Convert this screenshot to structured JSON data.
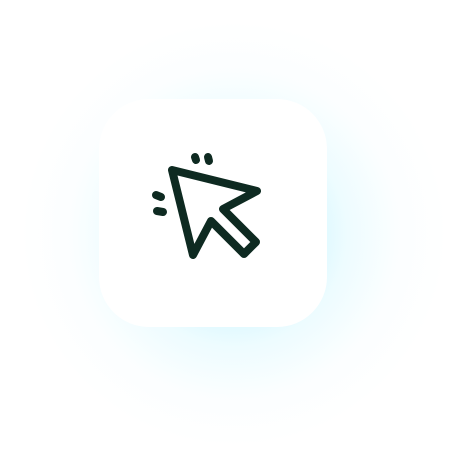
{
  "app_icon": {
    "icon": "cursor-click-icon",
    "card_color": "#ffffff",
    "glyph_color": "#0e2a21",
    "glow_color": "#a6eefc"
  }
}
